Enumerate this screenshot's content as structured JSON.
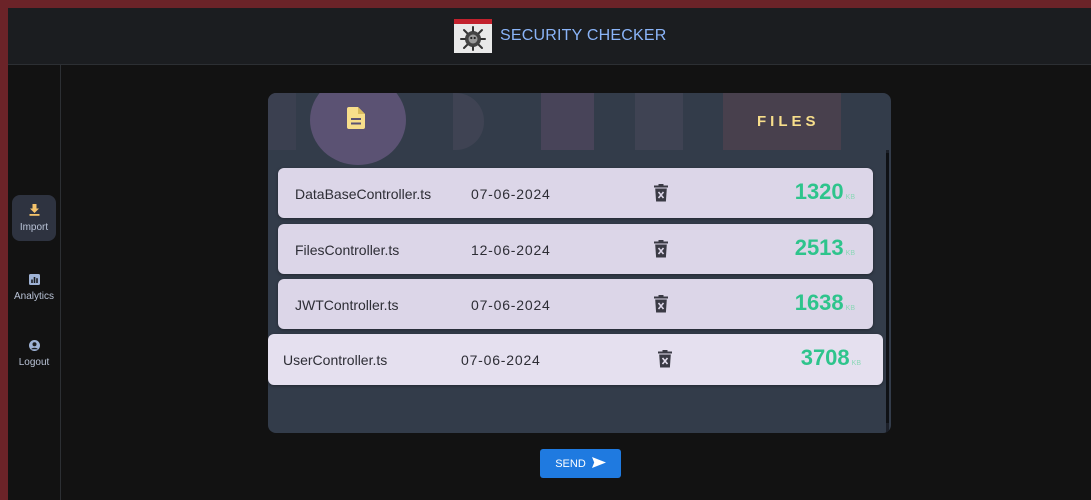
{
  "app": {
    "title": "SECURITY CHECKER",
    "logo_icon": "virus-scan-icon"
  },
  "sidebar": {
    "items": [
      {
        "label": "Import",
        "icon": "download-icon",
        "active": true
      },
      {
        "label": "Analytics",
        "icon": "bar-chart-icon",
        "active": false
      },
      {
        "label": "Logout",
        "icon": "user-circle-icon",
        "active": false
      }
    ]
  },
  "panel": {
    "title": "FILES",
    "header_icon": "document-icon"
  },
  "files": [
    {
      "name": "DataBaseController.ts",
      "date": "07-06-2024",
      "size": "1320",
      "unit": "KB"
    },
    {
      "name": "FilesController.ts",
      "date": "12-06-2024",
      "size": "2513",
      "unit": "KB"
    },
    {
      "name": "JWTController.ts",
      "date": "07-06-2024",
      "size": "1638",
      "unit": "KB"
    },
    {
      "name": "UserController.ts",
      "date": "07-06-2024",
      "size": "3708",
      "unit": "KB"
    }
  ],
  "actions": {
    "send_label": "SEND"
  },
  "colors": {
    "accent": "#1f7ae0",
    "size_text": "#2ec48c",
    "files_title": "#f7de8b",
    "row_bg": "#dcd6e8"
  }
}
